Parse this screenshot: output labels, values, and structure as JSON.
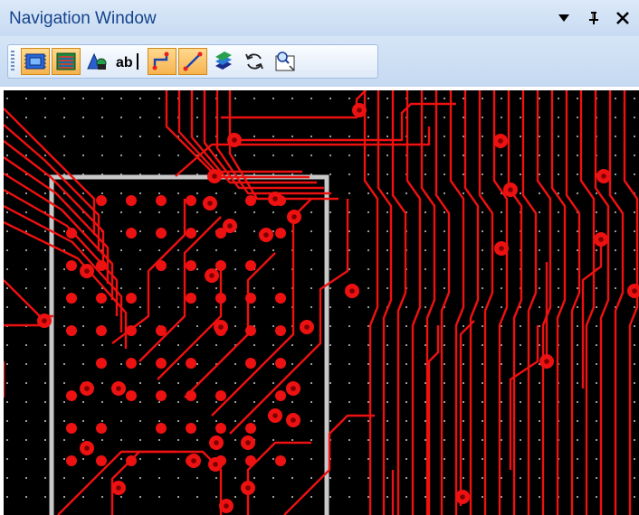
{
  "window": {
    "title": "Navigation Window"
  },
  "title_controls": [
    {
      "name": "dropdown-arrow-icon",
      "glyph": "▾"
    },
    {
      "name": "pin-icon",
      "glyph": "⊣"
    },
    {
      "name": "close-icon",
      "glyph": "✕"
    }
  ],
  "toolbar": {
    "buttons": [
      {
        "name": "board-view-button",
        "icon": "board-icon",
        "active": true
      },
      {
        "name": "layers-view-button",
        "icon": "layers-icon",
        "active": true
      },
      {
        "name": "shapes-button",
        "icon": "shapes-icon",
        "active": false
      },
      {
        "name": "text-button",
        "icon": "text-ab-icon",
        "active": false,
        "label": "ab|"
      },
      {
        "name": "route-button",
        "icon": "route-icon",
        "active": true
      },
      {
        "name": "diagonal-route-button",
        "icon": "diagonal-route-icon",
        "active": true
      },
      {
        "name": "layer-stack-button",
        "icon": "layer-stack-icon",
        "active": false
      },
      {
        "name": "refresh-button",
        "icon": "refresh-icon",
        "active": false
      },
      {
        "name": "zoom-extents-button",
        "icon": "zoom-window-icon",
        "active": false
      }
    ]
  },
  "colors": {
    "canvas_background": "#000000",
    "trace": "#ee1111",
    "grid_dot": "#9a9a9a",
    "board_outline": "#c8c8c8",
    "title_text": "#15428b",
    "active_button": "#f6b34f"
  }
}
